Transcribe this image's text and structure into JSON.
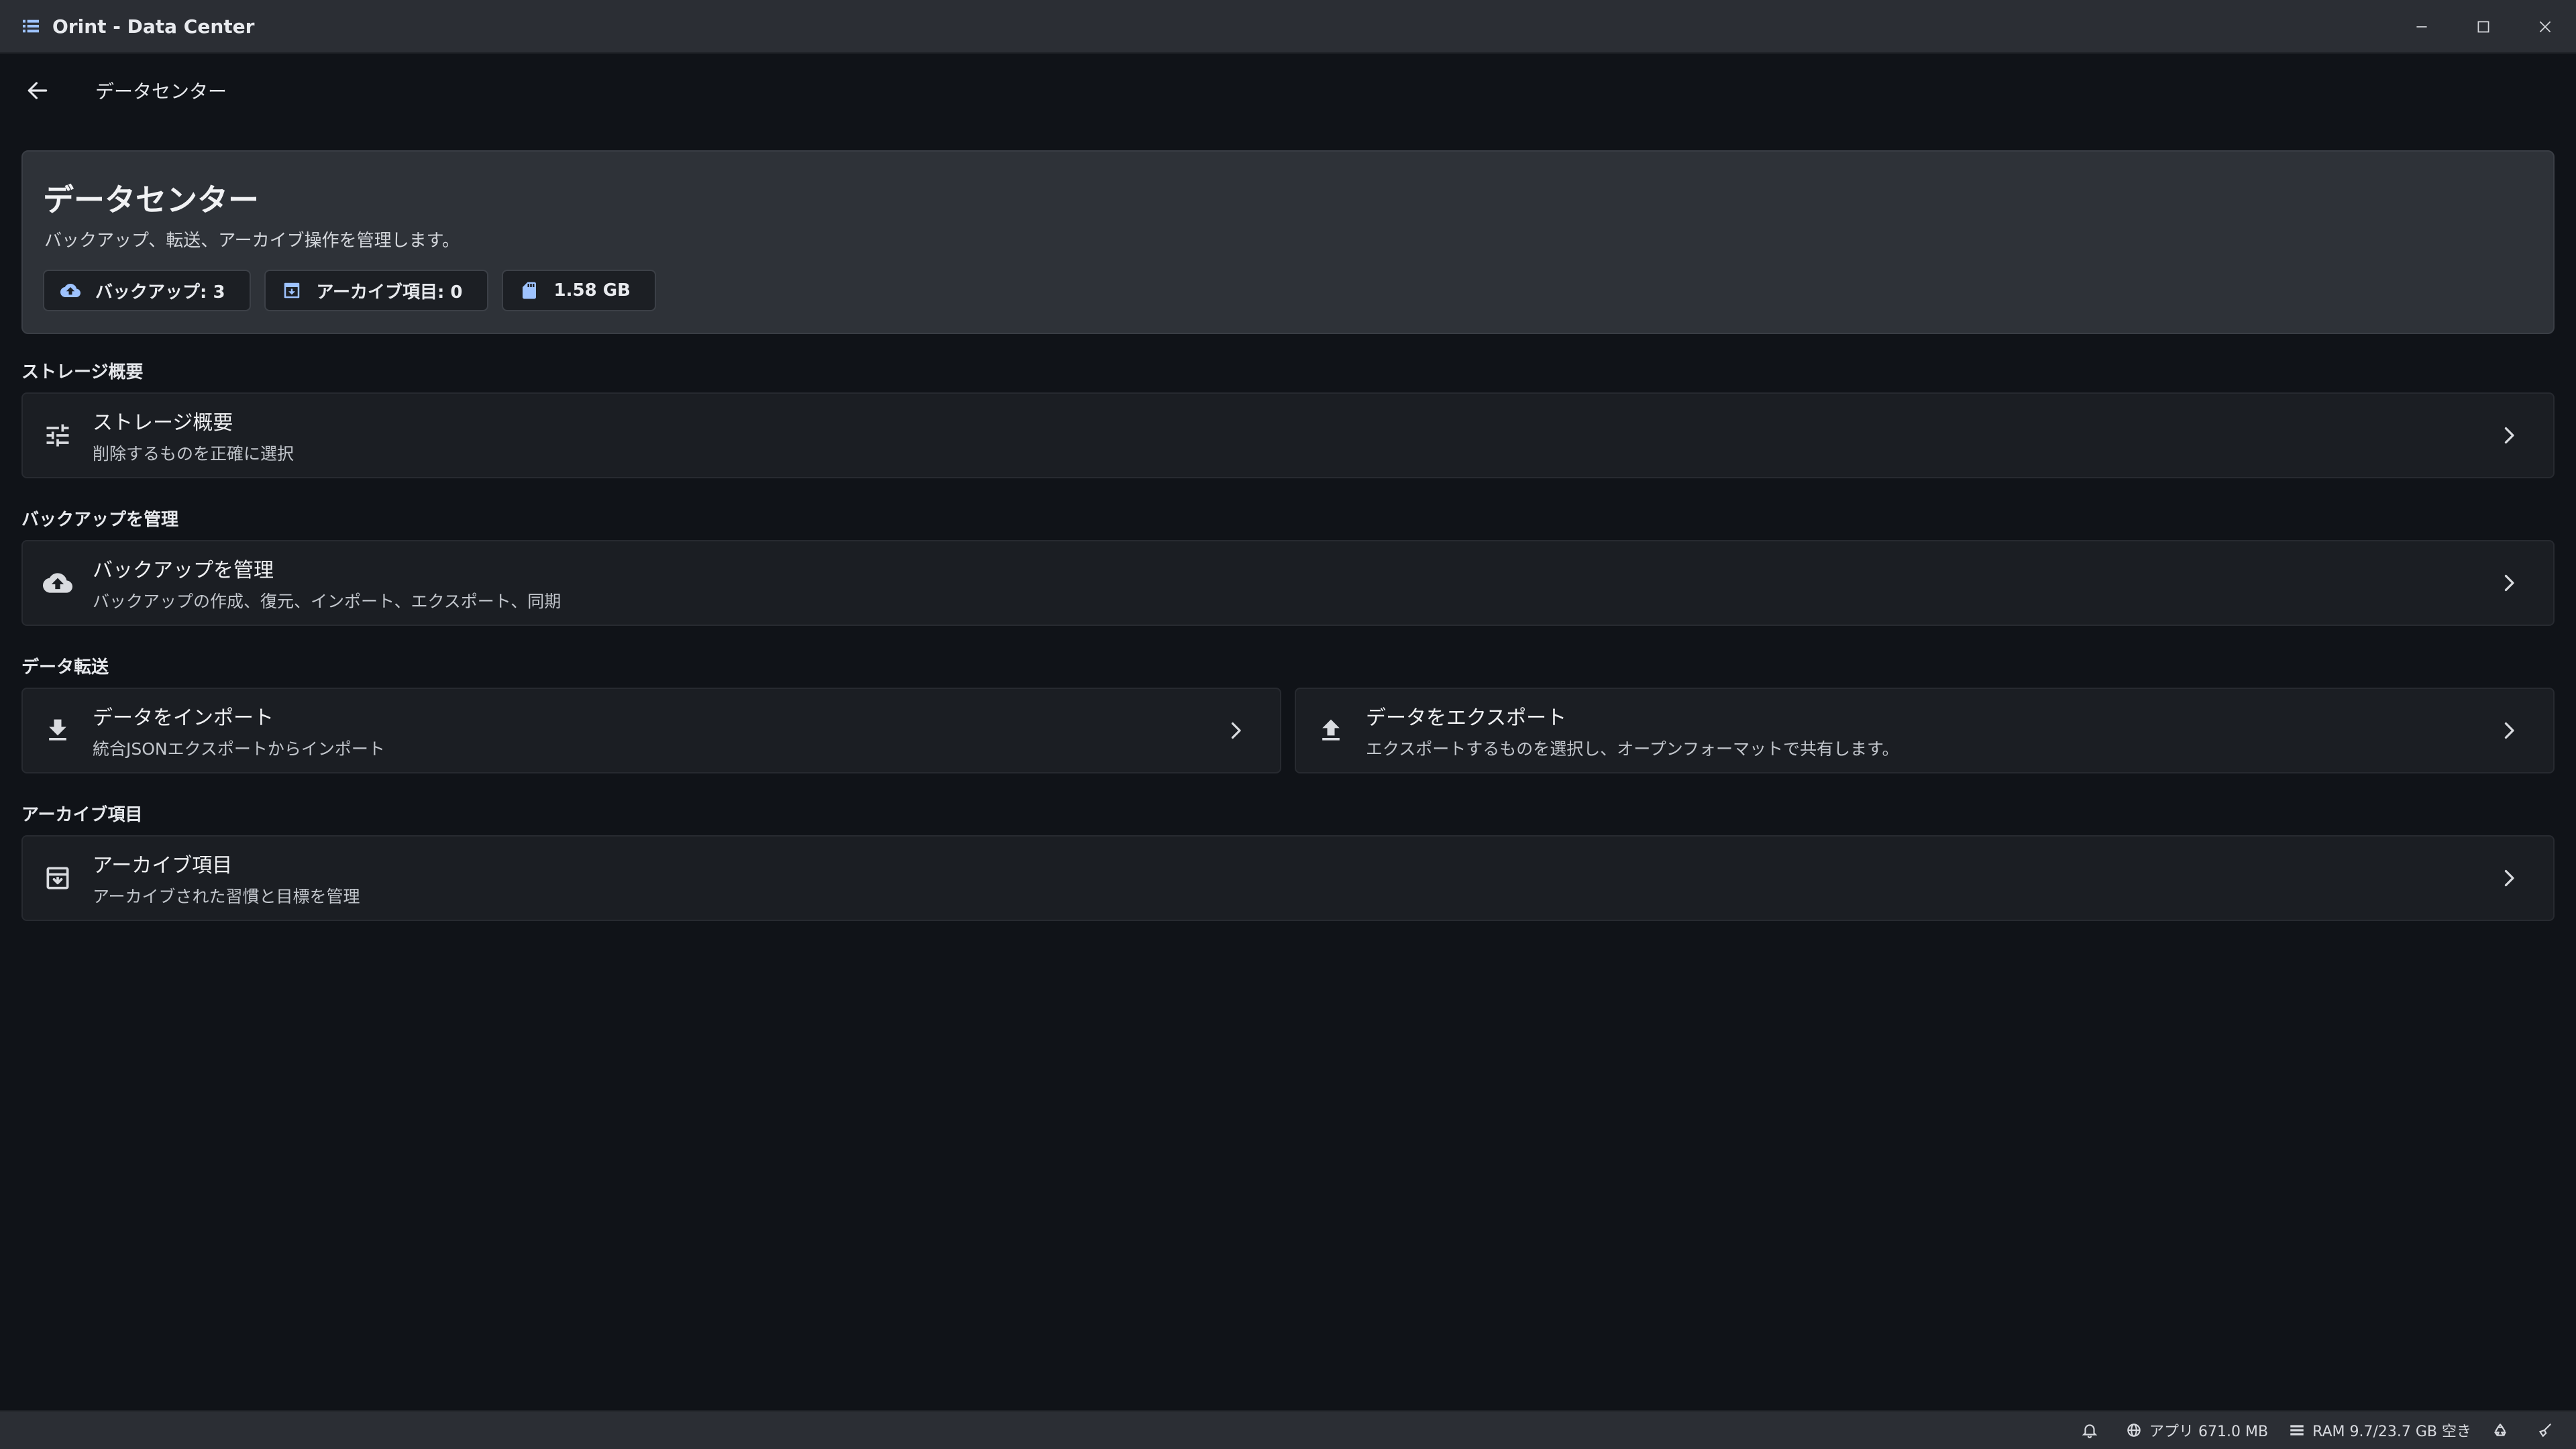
{
  "window": {
    "title": "Orint - Data Center"
  },
  "nav": {
    "title": "データセンター"
  },
  "hero": {
    "title": "データセンター",
    "subtitle": "バックアップ、転送、アーカイブ操作を管理します。",
    "chips": {
      "backups": "バックアップ: 3",
      "archived": "アーカイブ項目: 0",
      "size": "1.58 GB"
    }
  },
  "sections": {
    "storage": {
      "label": "ストレージ概要",
      "card_title": "ストレージ概要",
      "card_desc": "削除するものを正確に選択"
    },
    "backup": {
      "label": "バックアップを管理",
      "card_title": "バックアップを管理",
      "card_desc": "バックアップの作成、復元、インポート、エクスポート、同期"
    },
    "transfer": {
      "label": "データ転送",
      "import_title": "データをインポート",
      "import_desc": "統合JSONエクスポートからインポート",
      "export_title": "データをエクスポート",
      "export_desc": "エクスポートするものを選択し、オープンフォーマットで共有します。"
    },
    "archive": {
      "label": "アーカイブ項目",
      "card_title": "アーカイブ項目",
      "card_desc": "アーカイブされた習慣と目標を管理"
    }
  },
  "statusbar": {
    "app_memory": "アプリ 671.0 MB",
    "ram": "RAM 9.7/23.7 GB 空き"
  },
  "colors": {
    "background": "#101318",
    "titlebar": "#2b2e34",
    "card": "#1b1e23",
    "hero": "#2e3238",
    "accent": "#9ec3ff"
  },
  "icons": [
    "menu-icon",
    "minimize-icon",
    "maximize-icon",
    "close-icon",
    "arrow-back-icon",
    "cloud-upload-icon",
    "archive-icon",
    "sd-card-icon",
    "tune-icon",
    "download-icon",
    "upload-icon",
    "chevron-right-icon",
    "bell-icon",
    "globe-icon",
    "memory-icon",
    "recycle-icon",
    "broom-icon"
  ]
}
